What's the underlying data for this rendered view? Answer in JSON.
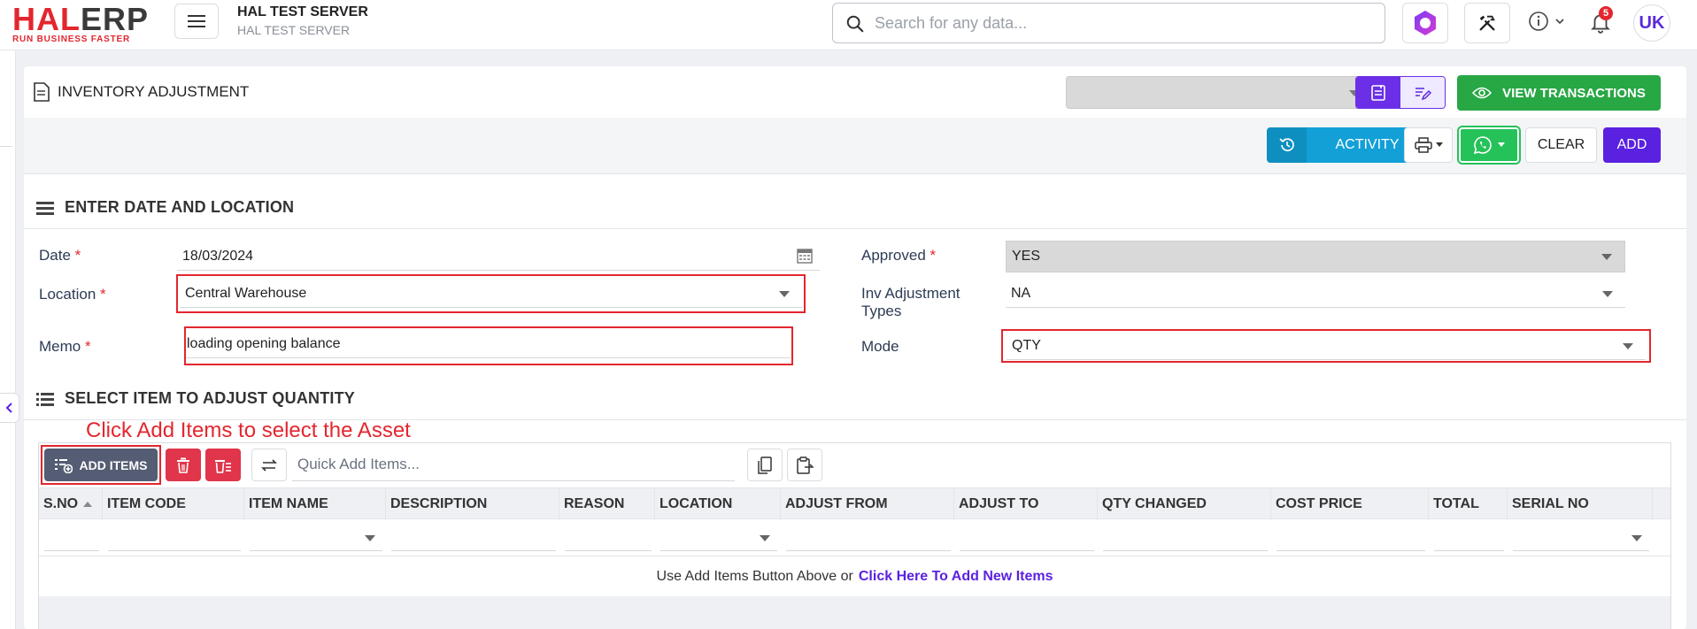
{
  "app": {
    "logo_main_a": "HAL",
    "logo_main_b": "ERP",
    "logo_tagline": "RUN BUSINESS FASTER",
    "server_title": "HAL TEST SERVER",
    "server_subtitle": "HAL TEST SERVER",
    "search_placeholder": "Search for any data...",
    "notifications_count": "5",
    "avatar_initials": "UK"
  },
  "page": {
    "title": "INVENTORY ADJUSTMENT",
    "view_transactions": "VIEW TRANSACTIONS",
    "activity": "ACTIVITY",
    "clear": "CLEAR",
    "add": "ADD"
  },
  "section1": {
    "title": "ENTER DATE AND LOCATION",
    "date_label": "Date",
    "date_value": "18/03/2024",
    "location_label": "Location",
    "location_value": "Central Warehouse",
    "memo_label": "Memo",
    "memo_value": "loading opening balance",
    "approved_label": "Approved",
    "approved_value": "YES",
    "types_label_1": "Inv Adjustment",
    "types_label_2": "Types",
    "types_value": "NA",
    "mode_label": "Mode",
    "mode_value": "QTY",
    "required_mark": "*"
  },
  "section2": {
    "title": "SELECT ITEM TO ADJUST QUANTITY",
    "annotation": "Click Add Items to select the Asset",
    "add_items": "ADD ITEMS",
    "quick_add_placeholder": "Quick Add Items...",
    "columns": [
      "S.NO",
      "ITEM CODE",
      "ITEM NAME",
      "DESCRIPTION",
      "REASON",
      "LOCATION",
      "ADJUST FROM",
      "ADJUST TO",
      "QTY CHANGED",
      "COST PRICE",
      "TOTAL",
      "SERIAL NO"
    ],
    "empty_text": "Use Add Items Button Above or",
    "empty_link": "Click Here To Add New Items"
  },
  "colors": {
    "brand_red": "#e3262e",
    "primary_purple": "#5a22e0",
    "success_green": "#28a745",
    "info_blue": "#12a0d7",
    "danger": "#e0354a"
  }
}
